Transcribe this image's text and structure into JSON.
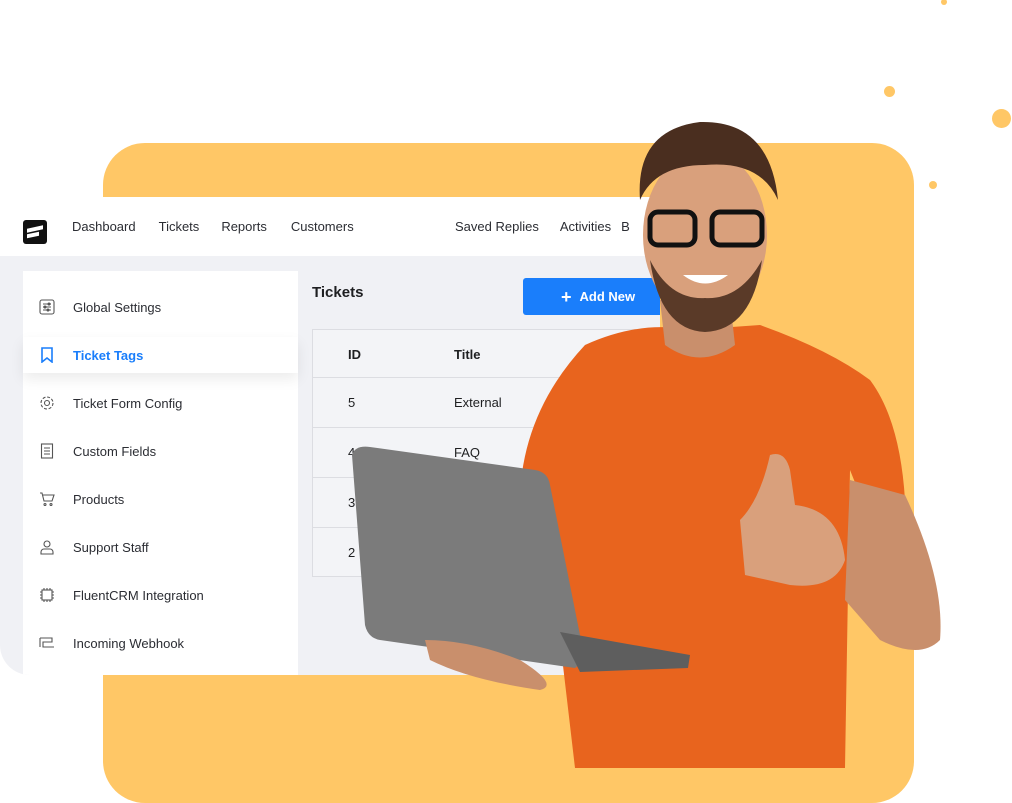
{
  "colors": {
    "accent": "#1A7EFB",
    "background_card": "#FFC766",
    "shirt": "#E8641E"
  },
  "nav": {
    "items": [
      "Dashboard",
      "Tickets",
      "Reports",
      "Customers",
      "Saved Replies",
      "Activities",
      "B"
    ]
  },
  "sidebar": {
    "items": [
      {
        "label": "Global Settings",
        "icon": "sliders-icon"
      },
      {
        "label": "Ticket Tags",
        "icon": "bookmark-icon",
        "active": true
      },
      {
        "label": "Ticket Form Config",
        "icon": "gear-icon"
      },
      {
        "label": "Custom Fields",
        "icon": "document-icon"
      },
      {
        "label": "Products",
        "icon": "cart-icon"
      },
      {
        "label": "Support Staff",
        "icon": "user-icon"
      },
      {
        "label": "FluentCRM Integration",
        "icon": "chip-icon"
      },
      {
        "label": "Incoming Webhook",
        "icon": "webhook-icon"
      }
    ]
  },
  "main": {
    "title": "Tickets",
    "add_button": "Add New",
    "table": {
      "columns": [
        "ID",
        "Title"
      ],
      "rows": [
        [
          "5",
          "External"
        ],
        [
          "4",
          "FAQ"
        ],
        [
          "3",
          ""
        ],
        [
          "2",
          ""
        ]
      ]
    }
  }
}
